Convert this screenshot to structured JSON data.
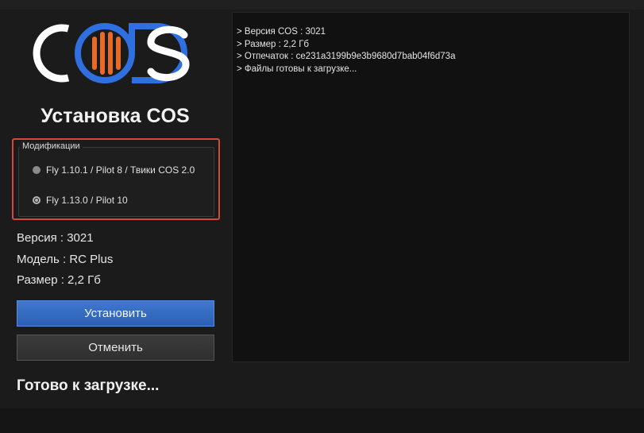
{
  "logo": {
    "text": "COS",
    "colors": {
      "letters": "#ffffff",
      "ring": "#2f6fe0",
      "bars": "#e86a2a"
    }
  },
  "title": "Установка COS",
  "mods": {
    "legend": "Модификации",
    "options": [
      {
        "label": "Fly 1.10.1 / Pilot 8 / Твики COS 2.0",
        "checked": false
      },
      {
        "label": "Fly 1.13.0 / Pilot 10",
        "checked": true
      }
    ]
  },
  "info": {
    "version": "Версия : 3021",
    "model": "Модель : RC Plus",
    "size": "Размер : 2,2 Гб"
  },
  "buttons": {
    "install": "Установить",
    "cancel": "Отменить"
  },
  "status": "Готово к загрузке...",
  "log": {
    "lines": [
      "> Версия COS : 3021",
      "> Размер : 2,2 Гб",
      "> Отпечаток : ce231a3199b9e3b9680d7bab04f6d73a",
      "> Файлы готовы к загрузке..."
    ]
  },
  "colors": {
    "highlight": "#d6473c",
    "accent": "#3f79cf",
    "background": "#1b1b1b",
    "log_bg": "#111111"
  }
}
